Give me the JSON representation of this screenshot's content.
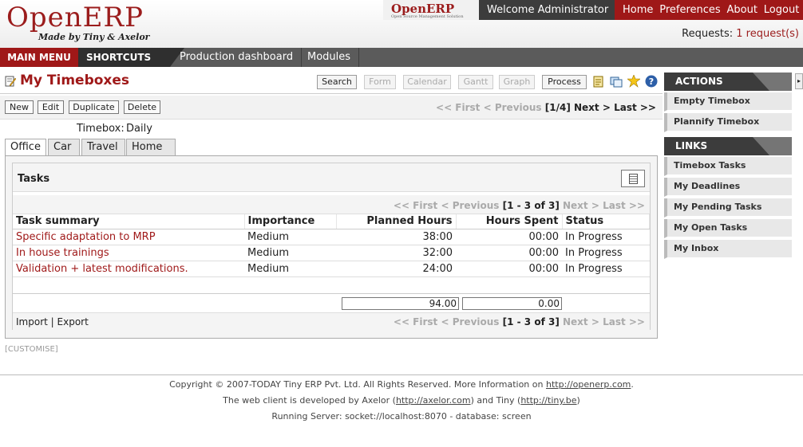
{
  "header": {
    "logo_text": "OpenERP",
    "logo_sub": "Made by Tiny & Axelor",
    "mini_logo": "OpenERP",
    "mini_logo_tagline": "Open Source Management Solution",
    "welcome": "Welcome Administrator",
    "nav": [
      "Home",
      "Preferences",
      "About",
      "Logout"
    ],
    "requests_label": "Requests:",
    "requests_link": "1 request(s)"
  },
  "menubar": {
    "main_menu": "MAIN MENU",
    "shortcuts": "SHORTCUTS",
    "links": [
      "Production dashboard",
      "Modules"
    ]
  },
  "page": {
    "title": "My Timeboxes",
    "view_buttons": [
      "Search",
      "Form",
      "Calendar",
      "Gantt",
      "Graph",
      "Process"
    ],
    "actions": [
      "New",
      "Edit",
      "Duplicate",
      "Delete"
    ],
    "pager": {
      "first": "<< First",
      "previous": "< Previous",
      "counter": "[1/4]",
      "next": "Next >",
      "last": "Last >>"
    }
  },
  "form": {
    "timebox_label": "Timebox:",
    "timebox_value": "Daily",
    "tabs": [
      "Office",
      "Car",
      "Travel",
      "Home"
    ]
  },
  "tasks": {
    "title": "Tasks",
    "pager": {
      "first": "<< First",
      "previous": "< Previous",
      "counter": "[1 - 3 of 3]",
      "next": "Next >",
      "last": "Last >>"
    },
    "columns": [
      "Task summary",
      "Importance",
      "Planned Hours",
      "Hours Spent",
      "Status"
    ],
    "rows": [
      {
        "summary": "Specific adaptation to MRP",
        "importance": "Medium",
        "planned": "38:00",
        "spent": "00:00",
        "status": "In Progress"
      },
      {
        "summary": "In house trainings",
        "importance": "Medium",
        "planned": "32:00",
        "spent": "00:00",
        "status": "In Progress"
      },
      {
        "summary": "Validation + latest modifications.",
        "importance": "Medium",
        "planned": "24:00",
        "spent": "00:00",
        "status": "In Progress"
      }
    ],
    "totals": {
      "planned": "94.00",
      "spent": "0.00"
    },
    "import": "Import",
    "separator": "|",
    "export": "Export"
  },
  "customise": "[CUSTOMISE]",
  "sidebar": {
    "actions_title": "ACTIONS",
    "actions": [
      "Empty Timebox",
      "Plannify Timebox"
    ],
    "links_title": "LINKS",
    "links": [
      "Timebox Tasks",
      "My Deadlines",
      "My Pending Tasks",
      "My Open Tasks",
      "My Inbox"
    ]
  },
  "footer": {
    "line1_text": "Copyright © 2007-TODAY Tiny ERP Pvt. Ltd. All Rights Reserved. More Information on",
    "line1_link": "http://openerp.com",
    "line2_a": "The web client is developed by Axelor (",
    "line2_link1": "http://axelor.com",
    "line2_b": ") and Tiny (",
    "line2_link2": "http://tiny.be",
    "line2_c": ")",
    "line3": "Running Server: socket://localhost:8070 - database: screen"
  },
  "colors": {
    "brand_red": "#9f1818",
    "dark_bar": "#3c3c3c",
    "menu_gray": "#5b5b5b"
  }
}
